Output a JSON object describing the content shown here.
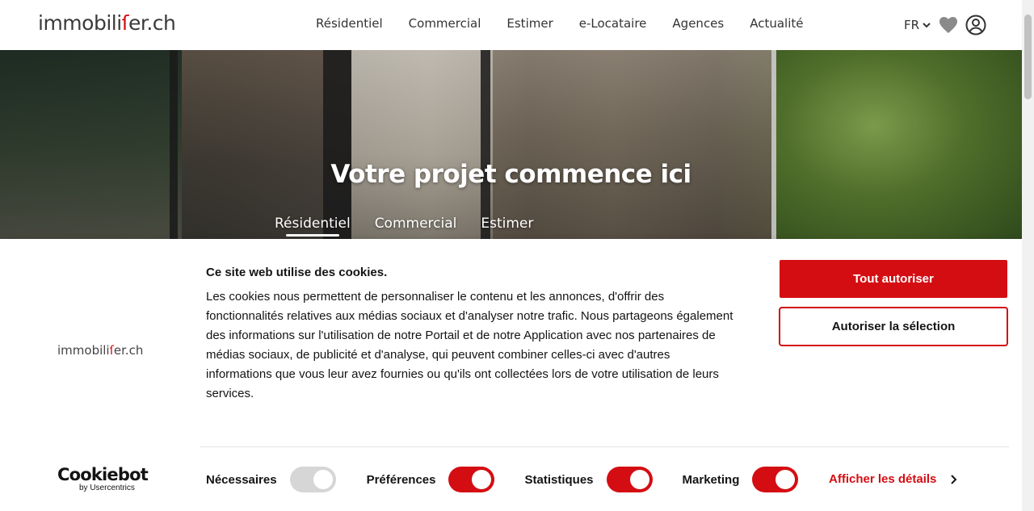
{
  "header": {
    "logo": {
      "part1": "immobili",
      "accent": "ſ",
      "part2": "er.ch"
    },
    "nav": [
      "Résidentiel",
      "Commercial",
      "Estimer",
      "e-Locataire",
      "Agences",
      "Actualité"
    ],
    "language": "FR",
    "icons": {
      "language_caret": "chevron-down-icon",
      "favorites": "heart-icon",
      "account": "user-circle-icon"
    }
  },
  "hero": {
    "title": "Votre projet commence ici",
    "tabs": [
      "Résidentiel",
      "Commercial",
      "Estimer"
    ],
    "active_tab": "Résidentiel"
  },
  "cookie_banner": {
    "logo": {
      "part1": "immobili",
      "accent": "ſ",
      "part2": "er.ch"
    },
    "title": "Ce site web utilise des cookies.",
    "body": "Les cookies nous permettent de personnaliser le contenu et les annonces, d'offrir des fonctionnalités relatives aux médias sociaux et d'analyser notre trafic. Nous partageons également des informations sur l'utilisation de notre Portail et de notre Application avec nos partenaires de médias sociaux, de publicité et d'analyse, qui peuvent combiner celles-ci avec d'autres informations que vous leur avez fournies ou qu'ils ont collectées lors de votre utilisation de leurs services.",
    "buttons": {
      "allow_all": "Tout autoriser",
      "allow_selection": "Autoriser la sélection"
    },
    "branding": {
      "name": "Cookiebot",
      "byline": "by Usercentrics"
    },
    "toggles": [
      {
        "label": "Nécessaires",
        "state": "on",
        "disabled": true
      },
      {
        "label": "Préférences",
        "state": "on",
        "disabled": false
      },
      {
        "label": "Statistiques",
        "state": "on",
        "disabled": false
      },
      {
        "label": "Marketing",
        "state": "on",
        "disabled": false
      }
    ],
    "details_link": "Afficher les détails"
  },
  "colors": {
    "accent": "#d40d12",
    "toggle_disabled": "#d6d6d6",
    "text": "#141414"
  }
}
